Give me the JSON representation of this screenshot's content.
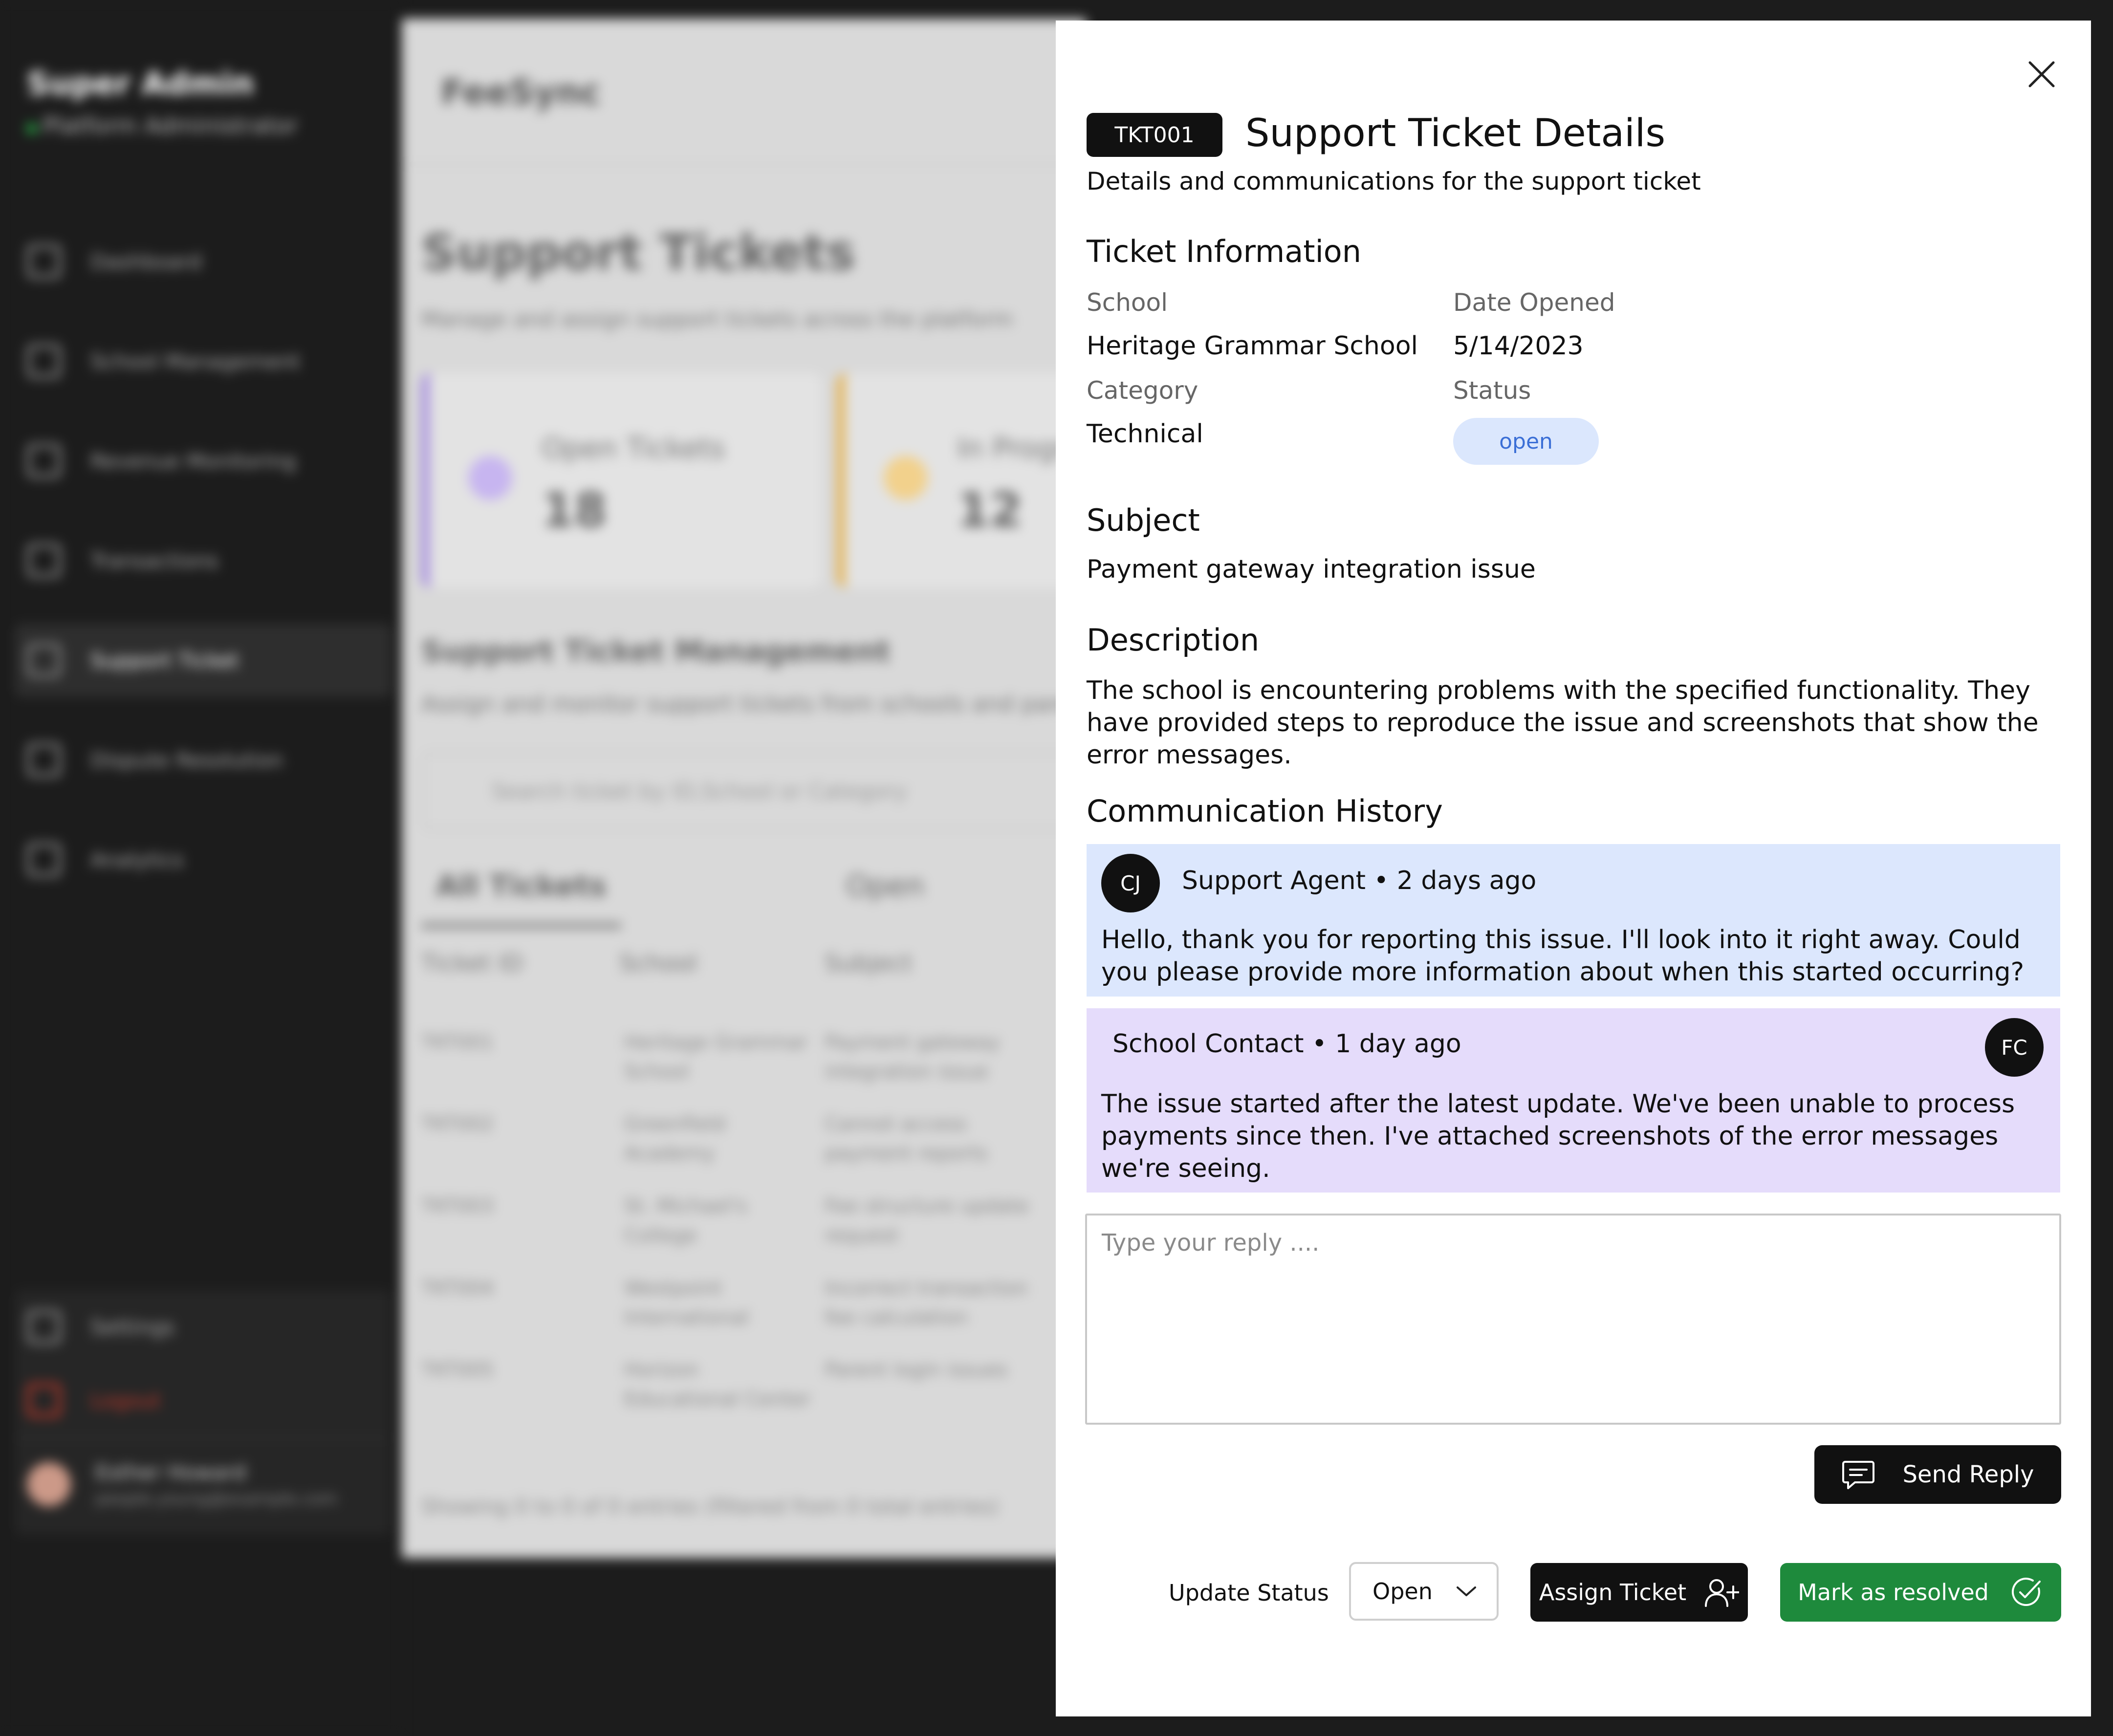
{
  "background": {
    "sidebar": {
      "brand": "Super Admin",
      "role": "Platform Administrator",
      "items": [
        {
          "label": "Dashboard",
          "icon": "dashboard-icon"
        },
        {
          "label": "School Management",
          "icon": "school-icon"
        },
        {
          "label": "Revenue Monitoring",
          "icon": "wallet-icon"
        },
        {
          "label": "Transactions",
          "icon": "chart-icon"
        },
        {
          "label": "Support Ticket",
          "icon": "chat-icon",
          "active": true
        },
        {
          "label": "Dispute Resolution",
          "icon": "scale-icon"
        },
        {
          "label": "Analytics",
          "icon": "bar-chart-icon"
        }
      ],
      "settings_label": "Settings",
      "logout_label": "Logout",
      "user_name": "Esther Howard",
      "user_email": "people.young@example.com"
    },
    "main": {
      "app_name": "FeeSync",
      "title": "Support Tickets",
      "subtitle": "Manage and assign support tickets across the platform",
      "cards": [
        {
          "label": "Open Tickets",
          "value": "18"
        },
        {
          "label": "In Progress",
          "value": "12"
        }
      ],
      "section_title": "Support Ticket Management",
      "section_subtitle": "Assign and monitor support tickets from schools and parents",
      "search_placeholder": "Search ticket by ID,School or Category",
      "tabs": [
        "All Tickets",
        "Open"
      ],
      "columns": [
        "Ticket ID",
        "School",
        "Subject"
      ],
      "rows": [
        [
          "TKT001",
          "Heritage Grammar School",
          "Payment gateway integration issue"
        ],
        [
          "TKT002",
          "Greenfield Academy",
          "Cannot access payment reports"
        ],
        [
          "TKT003",
          "St. Michael's College",
          "Fee structure update request"
        ],
        [
          "TKT004",
          "Westpoint International",
          "Incorrect transaction fee calculation"
        ],
        [
          "TKT005",
          "Horizon Educational Center",
          "Parent login issues"
        ]
      ],
      "footer": "Showing 0 to 0 of 0 entries (filtered from 0 total entries)"
    }
  },
  "modal": {
    "ticket_id": "TKT001",
    "title": "Support Ticket Details",
    "subtitle": "Details and communications for the support ticket",
    "info_heading": "Ticket Information",
    "fields": {
      "school_label": "School",
      "school_value": "Heritage Grammar School",
      "date_label": "Date Opened",
      "date_value": "5/14/2023",
      "category_label": "Category",
      "category_value": "Technical",
      "status_label": "Status",
      "status_value": "open"
    },
    "subject_heading": "Subject",
    "subject": "Payment gateway integration issue",
    "description_heading": "Description",
    "description": "The school is encountering problems with the specified functionality. They have provided steps to reproduce the issue and screenshots that show the error messages.",
    "history_heading": "Communication History",
    "messages": [
      {
        "initials": "CJ",
        "header": "Support Agent • 2 days ago",
        "body": "Hello, thank you for reporting this issue. I'll look into it right away. Could you please provide more information about when this started occurring?",
        "color": "#dce7fd"
      },
      {
        "initials": "FC",
        "header": "School Contact • 1 day ago",
        "body": "The issue started after the latest update. We've been unable to process payments since then. I've attached screenshots of the error messages we're seeing.",
        "color": "#e5dcfb"
      }
    ],
    "reply_placeholder": "Type your reply ....",
    "send_label": "Send Reply",
    "update_status_label": "Update Status",
    "status_select_value": "Open",
    "assign_label": "Assign Ticket",
    "resolve_label": "Mark as resolved",
    "colors": {
      "resolve_green": "#1e8a3c",
      "status_pill_bg": "#dbe7fd",
      "status_pill_text": "#3b6fd6"
    }
  }
}
